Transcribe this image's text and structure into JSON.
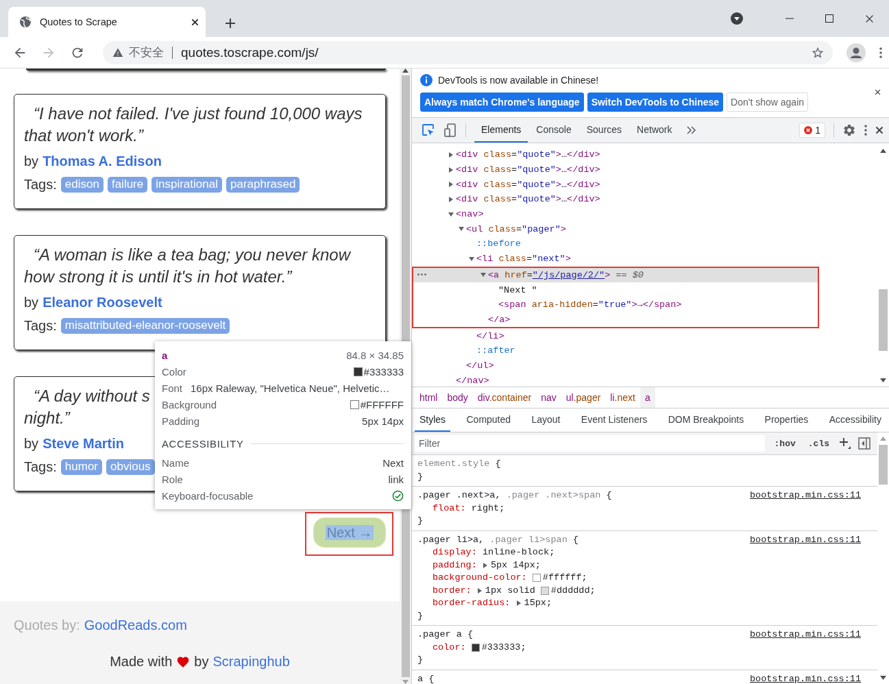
{
  "browser": {
    "tab_title": "Quotes to Scrape",
    "security": "不安全",
    "url": "quotes.toscrape.com/js/"
  },
  "page": {
    "quotes": [
      {
        "text": "“I have not failed. I've just found 10,000 ways that won't work.”",
        "by": "by",
        "author": "Thomas A. Edison",
        "tags_label": "Tags:",
        "tags": [
          "edison",
          "failure",
          "inspirational",
          "paraphrased"
        ]
      },
      {
        "text": "“A woman is like a tea bag; you never know how strong it is until it's in hot water.”",
        "by": "by",
        "author": "Eleanor Roosevelt",
        "tags_label": "Tags:",
        "tags": [
          "misattributed-eleanor-roosevelt"
        ]
      },
      {
        "text": "“A day without s\nnight.”",
        "by": "by",
        "author": "Steve Martin",
        "tags_label": "Tags:",
        "tags": [
          "humor",
          "obvious"
        ]
      }
    ],
    "next_button": {
      "label": "Next →",
      "highlighted": true,
      "annotated": true
    },
    "footer": {
      "credit_label": "Quotes by:",
      "credit_link": "GoodReads.com",
      "made_with": "Made with",
      "by": "by",
      "maker": "Scrapinghub"
    }
  },
  "inspect_tooltip": {
    "element": "a",
    "size": "84.8 × 34.85",
    "properties": [
      {
        "label": "Color",
        "value": "#333333",
        "swatch": true
      },
      {
        "label": "Font",
        "value": "16px Raleway, \"Helvetica Neue\", Helvetic…",
        "swatch": false
      },
      {
        "label": "Background",
        "value": "#FFFFFF",
        "swatch": true
      },
      {
        "label": "Padding",
        "value": "5px 14px",
        "swatch": false
      }
    ],
    "section": "ACCESSIBILITY",
    "accessibility": [
      {
        "label": "Name",
        "value": "Next"
      },
      {
        "label": "Role",
        "value": "link"
      },
      {
        "label": "Keyboard-focusable",
        "focusable": true
      }
    ]
  },
  "devtools": {
    "infobar": {
      "message": "DevTools is now available in Chinese!",
      "buttons": [
        {
          "label": "Always match Chrome's language",
          "primary": true
        },
        {
          "label": "Switch DevTools to Chinese",
          "primary": true
        },
        {
          "label": "Don't show again",
          "primary": false
        }
      ]
    },
    "tabs": [
      {
        "label": "Elements",
        "selected": true
      },
      {
        "label": "Console",
        "selected": false
      },
      {
        "label": "Sources",
        "selected": false
      },
      {
        "label": "Network",
        "selected": false
      }
    ],
    "error_count": "1",
    "dom_tree": [
      {
        "line": "<div class=\"quote\">…</div>",
        "expanded": false,
        "selected": false
      },
      {
        "line": "<div class=\"quote\">…</div>",
        "expanded": false,
        "selected": false
      },
      {
        "line": "<div class=\"quote\">…</div>",
        "expanded": false,
        "selected": false
      },
      {
        "line": "<div class=\"quote\">…</div>",
        "expanded": false,
        "selected": false
      },
      {
        "line": "<nav>",
        "expanded": true,
        "selected": false,
        "close": "</nav>",
        "children": [
          {
            "line": "<ul class=\"pager\">",
            "expanded": true,
            "selected": false,
            "close": "</ul>",
            "children": [
              {
                "line": "::before",
                "kind": "pseudo",
                "selected": false
              },
              {
                "line": "<li class=\"next\">",
                "expanded": true,
                "selected": false,
                "close": "</li>",
                "children": [
                  {
                    "line": "<a href=\"/js/page/2/\">",
                    "expanded": true,
                    "selected": true,
                    "link": true,
                    "annotated": true,
                    "suffix": "== $0",
                    "close": "</a>",
                    "children": [
                      {
                        "line": "\"Next \"",
                        "kind": "text",
                        "selected": false
                      },
                      {
                        "line": "<span aria-hidden=\"true\">→</span>",
                        "selected": false
                      }
                    ]
                  }
                ]
              },
              {
                "line": "::after",
                "kind": "pseudo",
                "selected": false
              }
            ]
          }
        ]
      }
    ],
    "breadcrumbs": [
      {
        "label": "html",
        "selected": false
      },
      {
        "label": "body",
        "selected": false
      },
      {
        "label": "div.container",
        "selected": false
      },
      {
        "label": "nav",
        "selected": false
      },
      {
        "label": "ul.pager",
        "selected": false
      },
      {
        "label": "li.next",
        "selected": false
      },
      {
        "label": "a",
        "selected": true
      }
    ],
    "style_tabs": [
      {
        "label": "Styles",
        "selected": true
      },
      {
        "label": "Computed",
        "selected": false
      },
      {
        "label": "Layout",
        "selected": false
      },
      {
        "label": "Event Listeners",
        "selected": false
      },
      {
        "label": "DOM Breakpoints",
        "selected": false
      },
      {
        "label": "Properties",
        "selected": false
      },
      {
        "label": "Accessibility",
        "selected": false
      }
    ],
    "filter": {
      "placeholder": "Filter"
    },
    "toggles": [
      ":hov",
      ".cls"
    ],
    "rules": [
      {
        "selector": [
          {
            "text": "element.style",
            "dimmed": true
          }
        ],
        "open": "{",
        "close": "}"
      },
      {
        "selector": [
          {
            "text": ".pager .next>a,",
            "dimmed": false
          },
          {
            "text": ".pager .next>span",
            "dimmed": true
          }
        ],
        "open": "{",
        "source": "bootstrap.min.css:11",
        "declarations": [
          {
            "property": "float:",
            "value": "right;",
            "shorthand": false,
            "swatch": false
          }
        ],
        "close": "}"
      },
      {
        "selector": [
          {
            "text": ".pager li>a,",
            "dimmed": false
          },
          {
            "text": ".pager li>span",
            "dimmed": true
          }
        ],
        "open": "{",
        "source": "bootstrap.min.css:11",
        "declarations": [
          {
            "property": "display:",
            "value": "inline-block;",
            "shorthand": false,
            "swatch": false
          },
          {
            "property": "padding:",
            "value": "5px 14px;",
            "shorthand": true,
            "swatch": false
          },
          {
            "property": "background-color:",
            "value": "#ffffff;",
            "shorthand": false,
            "swatch": true
          },
          {
            "property": "border:",
            "value": "1px solid",
            "shorthand": true,
            "swatch": true,
            "value_after": "#dddddd;"
          },
          {
            "property": "border-radius:",
            "value": "15px;",
            "shorthand": true,
            "swatch": false
          }
        ],
        "close": "}"
      },
      {
        "selector": [
          {
            "text": ".pager a",
            "dimmed": false
          }
        ],
        "open": "{",
        "source": "bootstrap.min.css:11",
        "declarations": [
          {
            "property": "color:",
            "value": "#333333;",
            "shorthand": false,
            "swatch": true
          }
        ],
        "close": "}"
      },
      {
        "selector": [
          {
            "text": "a",
            "dimmed": false
          }
        ],
        "open": "{",
        "source": "bootstrap.min.css:11"
      }
    ]
  }
}
